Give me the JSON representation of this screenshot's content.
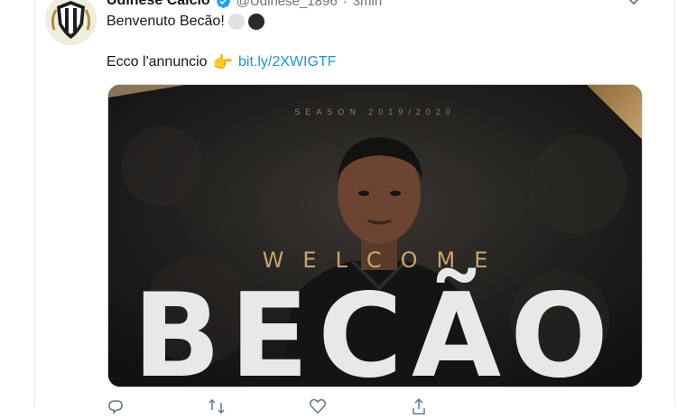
{
  "tweet": {
    "display_name": "Udinese Calcio",
    "handle": "@Udinese_1896",
    "separator": "·",
    "time": "3min",
    "line1": "Benvenuto Becão!",
    "line2_text": "Ecco l'annuncio",
    "pointer_emoji": "👉",
    "link": "bit.ly/2XWIGTF"
  },
  "media": {
    "season_label": "SEASON 2019/2020",
    "welcome_label": "WELCOME",
    "player_name": "BECÃO"
  },
  "icons": {
    "verified": "verified-badge-icon",
    "more": "chevron-down-icon",
    "reply": "reply-icon",
    "retweet": "retweet-icon",
    "like": "heart-icon",
    "share": "share-icon"
  },
  "colors": {
    "link": "#1b95e0",
    "verified": "#1da1f2",
    "gold": "#c9a36e",
    "muted": "#657786"
  }
}
